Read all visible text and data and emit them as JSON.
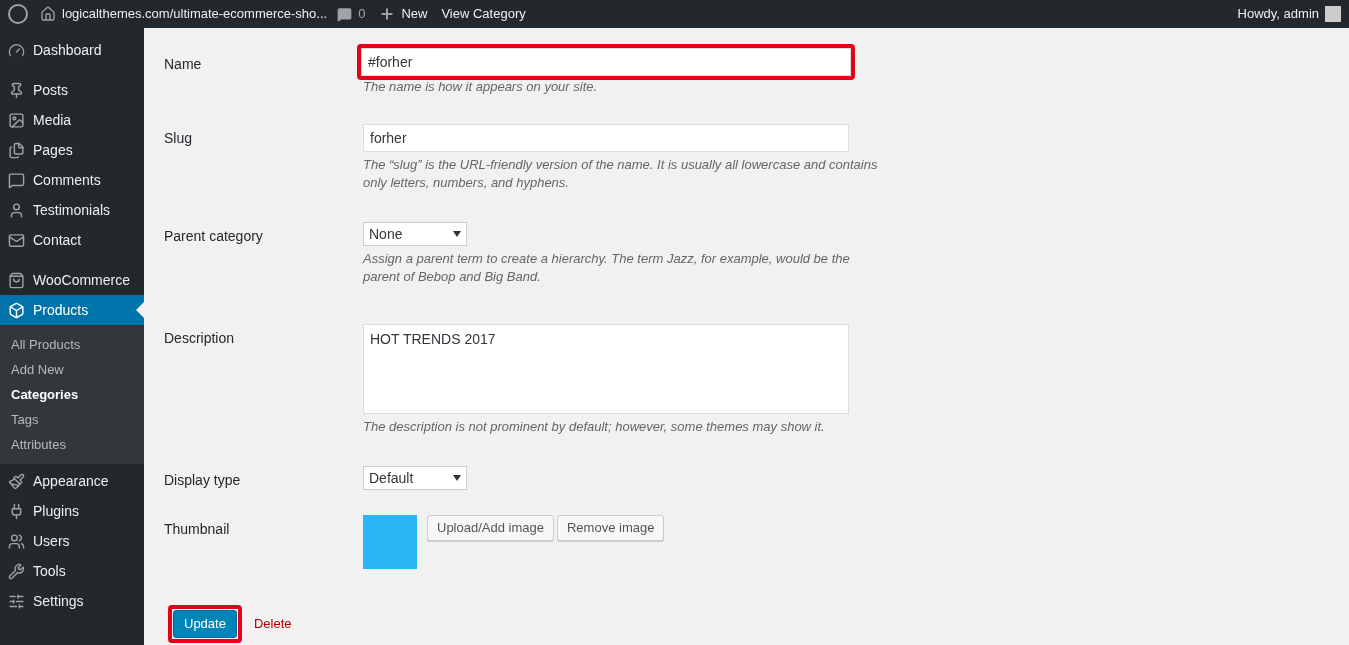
{
  "admin_bar": {
    "site": "logicalthemes.com/ultimate-ecommerce-sho...",
    "comments": "0",
    "new": "New",
    "view": "View Category",
    "greeting": "Howdy, admin"
  },
  "sidebar": {
    "groups": [
      [
        {
          "label": "Dashboard",
          "selected": false
        }
      ],
      [
        {
          "label": "Posts",
          "selected": false
        },
        {
          "label": "Media",
          "selected": false
        },
        {
          "label": "Pages",
          "selected": false
        },
        {
          "label": "Comments",
          "selected": false
        },
        {
          "label": "Testimonials",
          "selected": false
        },
        {
          "label": "Contact",
          "selected": false
        }
      ],
      [
        {
          "label": "WooCommerce",
          "selected": false
        },
        {
          "label": "Products",
          "selected": true,
          "children": [
            {
              "label": "All Products",
              "selected": false
            },
            {
              "label": "Add New",
              "selected": false
            },
            {
              "label": "Categories",
              "selected": true
            },
            {
              "label": "Tags",
              "selected": false
            },
            {
              "label": "Attributes",
              "selected": false
            }
          ]
        },
        {
          "label": "Appearance",
          "selected": false
        },
        {
          "label": "Plugins",
          "selected": false
        },
        {
          "label": "Users",
          "selected": false
        },
        {
          "label": "Tools",
          "selected": false
        },
        {
          "label": "Settings",
          "selected": false
        }
      ]
    ]
  },
  "form": {
    "fields": [
      {
        "kind": "text",
        "label": "Name",
        "value": "#forher",
        "highlighted": true,
        "help": "The name is how it appears on your site."
      },
      {
        "kind": "text",
        "label": "Slug",
        "value": "forher",
        "highlighted": false,
        "help": "The “slug” is the URL-friendly version of the name. It is usually all lowercase and contains only letters, numbers, and hyphens."
      },
      {
        "kind": "select",
        "label": "Parent category",
        "value": "None",
        "help": "Assign a parent term to create a hierarchy. The term Jazz, for example, would be the parent of Bebop and Big Band."
      },
      {
        "kind": "textarea",
        "label": "Description",
        "value": "HOT TRENDS 2017",
        "help": "The description is not prominent by default; however, some themes may show it."
      },
      {
        "kind": "select",
        "label": "Display type",
        "value": "Default"
      },
      {
        "kind": "thumbnail",
        "label": "Thumbnail",
        "buttons": [
          "Upload/Add image",
          "Remove image"
        ]
      }
    ],
    "update": {
      "label": "Update",
      "highlighted": true
    },
    "delete": "Delete"
  }
}
